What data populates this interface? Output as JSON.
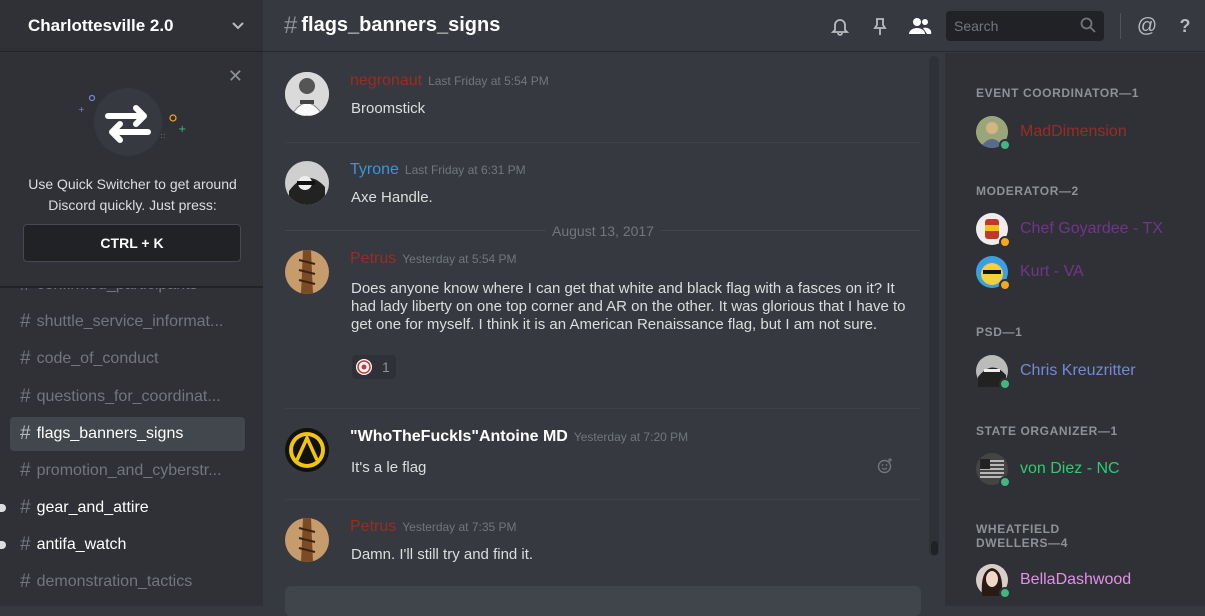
{
  "server": {
    "name": "Charlottesville 2.0"
  },
  "quick_switcher": {
    "line1": "Use Quick Switcher to get around",
    "line2": "Discord quickly. Just press:",
    "shortcut": "CTRL + K"
  },
  "channels": [
    {
      "name": "confirmed_participants"
    },
    {
      "name": "shuttle_service_informat..."
    },
    {
      "name": "code_of_conduct"
    },
    {
      "name": "questions_for_coordinat..."
    },
    {
      "name": "flags_banners_signs"
    },
    {
      "name": "promotion_and_cyberstr..."
    },
    {
      "name": "gear_and_attire"
    },
    {
      "name": "antifa_watch"
    },
    {
      "name": "demonstration_tactics"
    }
  ],
  "header": {
    "channel": "flags_banners_signs",
    "search_placeholder": "Search"
  },
  "messages": [
    {
      "author": "negronaut",
      "time": "Last Friday at 5:54 PM",
      "text": "Broomstick",
      "color": "#992d22"
    },
    {
      "author": "Tyrone",
      "time": "Last Friday at 6:31 PM",
      "text": "Axe Handle.",
      "color": "#3498db"
    },
    {
      "author": "Petrus",
      "time": "Yesterday at 5:54 PM",
      "text": "Does anyone know where I can get that white and black flag with a fasces on it? It had lady liberty on one top corner and AR on the other. It was glorious that I have to get one for myself. I think it is an American Renaissance flag, but I am not sure.",
      "color": "#992d22",
      "reaction_count": "1"
    },
    {
      "author": "\"WhoTheFuckIs\"Antoine MD",
      "time": "Yesterday at 7:20 PM",
      "text": "It's a le flag",
      "color": "#ffffff"
    },
    {
      "author": "Petrus",
      "time": "Yesterday at 7:35 PM",
      "text": "Damn. I'll still try and find it.",
      "color": "#992d22"
    }
  ],
  "date_divider": "August 13, 2017",
  "members": {
    "roles": [
      {
        "label": "EVENT COORDINATOR—1"
      },
      {
        "label": "MODERATOR—2"
      },
      {
        "label": "PSD—1"
      },
      {
        "label": "STATE ORGANIZER—1"
      },
      {
        "label": "WHEATFIELD",
        "label2": "DWELLERS—4"
      }
    ],
    "list": [
      {
        "name": "MadDimension",
        "color": "#992d22",
        "status": "online"
      },
      {
        "name": "Chef Goyardee - TX",
        "color": "#71368a",
        "status": "idle"
      },
      {
        "name": "Kurt - VA",
        "color": "#71368a",
        "status": "idle"
      },
      {
        "name": "Chris Kreuzritter",
        "color": "#7289da",
        "status": "online"
      },
      {
        "name": "von Diez - NC",
        "color": "#2ecc71",
        "status": "online"
      },
      {
        "name": "BellaDashwood",
        "color": "#e390e7",
        "status": "online"
      }
    ]
  },
  "colors": {
    "online": "#43b581",
    "idle": "#faa61a",
    "accent": "#7289da"
  }
}
